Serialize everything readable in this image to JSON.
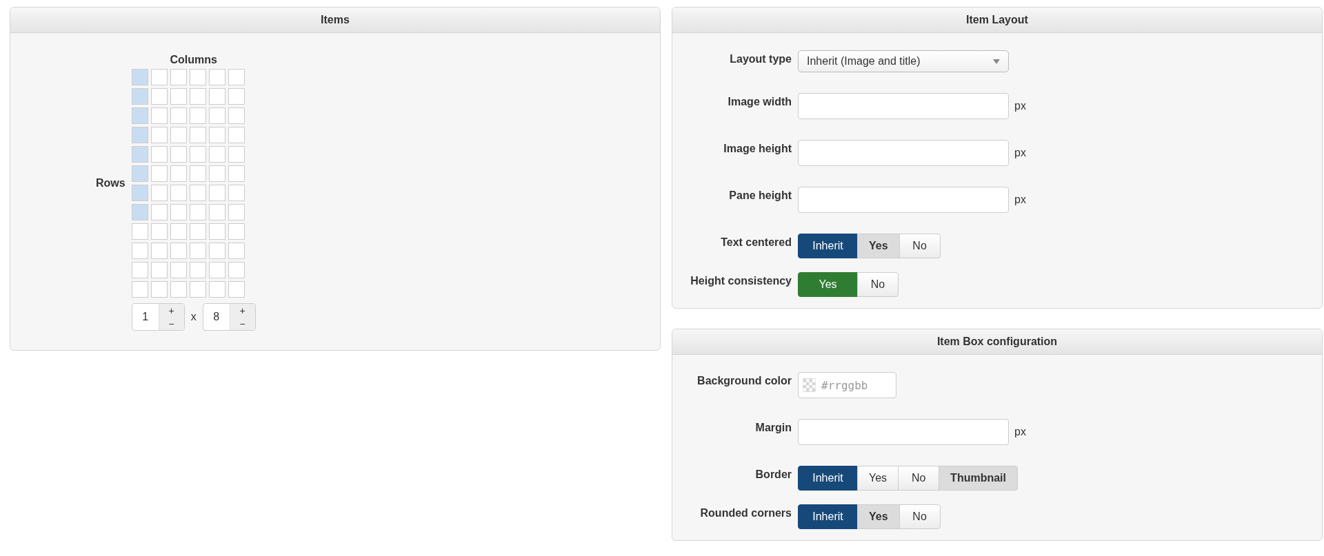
{
  "items_panel": {
    "title": "Items",
    "columns_label": "Columns",
    "rows_label": "Rows",
    "grid": [
      [
        {
          "selected": true
        },
        {
          "selected": false
        },
        {
          "selected": false
        },
        {
          "selected": false
        },
        {
          "selected": false
        },
        {
          "selected": false
        }
      ],
      [
        {
          "selected": true
        },
        {
          "selected": false
        },
        {
          "selected": false
        },
        {
          "selected": false
        },
        {
          "selected": false
        },
        {
          "selected": false
        }
      ],
      [
        {
          "selected": true
        },
        {
          "selected": false
        },
        {
          "selected": false
        },
        {
          "selected": false
        },
        {
          "selected": false
        },
        {
          "selected": false
        }
      ],
      [
        {
          "selected": true
        },
        {
          "selected": false
        },
        {
          "selected": false
        },
        {
          "selected": false
        },
        {
          "selected": false
        },
        {
          "selected": false
        }
      ],
      [
        {
          "selected": true
        },
        {
          "selected": false
        },
        {
          "selected": false
        },
        {
          "selected": false
        },
        {
          "selected": false
        },
        {
          "selected": false
        }
      ],
      [
        {
          "selected": true
        },
        {
          "selected": false
        },
        {
          "selected": false
        },
        {
          "selected": false
        },
        {
          "selected": false
        },
        {
          "selected": false
        }
      ],
      [
        {
          "selected": true
        },
        {
          "selected": false
        },
        {
          "selected": false
        },
        {
          "selected": false
        },
        {
          "selected": false
        },
        {
          "selected": false
        }
      ],
      [
        {
          "selected": true
        },
        {
          "selected": false
        },
        {
          "selected": false
        },
        {
          "selected": false
        },
        {
          "selected": false
        },
        {
          "selected": false
        }
      ],
      [
        {
          "selected": false
        },
        {
          "selected": false
        },
        {
          "selected": false
        },
        {
          "selected": false
        },
        {
          "selected": false
        },
        {
          "selected": false
        }
      ],
      [
        {
          "selected": false
        },
        {
          "selected": false
        },
        {
          "selected": false
        },
        {
          "selected": false
        },
        {
          "selected": false
        },
        {
          "selected": false
        }
      ],
      [
        {
          "selected": false
        },
        {
          "selected": false
        },
        {
          "selected": false
        },
        {
          "selected": false
        },
        {
          "selected": false
        },
        {
          "selected": false
        }
      ],
      [
        {
          "selected": false
        },
        {
          "selected": false
        },
        {
          "selected": false
        },
        {
          "selected": false
        },
        {
          "selected": false
        },
        {
          "selected": false
        }
      ]
    ],
    "steppers": [
      {
        "value": "1",
        "plus": "+",
        "minus": "−"
      },
      {
        "value": "8",
        "plus": "+",
        "minus": "−"
      }
    ],
    "separator": "x"
  },
  "panels": [
    {
      "title": "Item Layout",
      "fields": [
        {
          "kind": "select",
          "label": "Layout type",
          "value": "Inherit (Image and title)"
        },
        {
          "kind": "text",
          "label": "Image width",
          "unit": "px"
        },
        {
          "kind": "text",
          "label": "Image height",
          "unit": "px"
        },
        {
          "kind": "text",
          "label": "Pane height",
          "unit": "px"
        },
        {
          "kind": "toggle",
          "label": "Text centered",
          "color": "#164979",
          "options": [
            {
              "label": "Inherit",
              "selected": true,
              "inherited": false
            },
            {
              "label": "Yes",
              "selected": false,
              "inherited": true
            },
            {
              "label": "No",
              "selected": false,
              "inherited": false
            }
          ]
        },
        {
          "kind": "toggle",
          "label": "Height consistency",
          "color": "#2f7d32",
          "options": [
            {
              "label": "Yes",
              "selected": true,
              "inherited": false
            },
            {
              "label": "No",
              "selected": false,
              "inherited": false
            }
          ]
        }
      ]
    },
    {
      "title": "Item Box configuration",
      "fields": [
        {
          "kind": "color",
          "label": "Background color",
          "placeholder": "#rrggbb"
        },
        {
          "kind": "text",
          "label": "Margin",
          "unit": "px"
        },
        {
          "kind": "toggle",
          "label": "Border",
          "color": "#164979",
          "options": [
            {
              "label": "Inherit",
              "selected": true,
              "inherited": false
            },
            {
              "label": "Yes",
              "selected": false,
              "inherited": false
            },
            {
              "label": "No",
              "selected": false,
              "inherited": false
            },
            {
              "label": "Thumbnail",
              "selected": false,
              "inherited": true
            }
          ]
        },
        {
          "kind": "toggle",
          "label": "Rounded corners",
          "color": "#164979",
          "options": [
            {
              "label": "Inherit",
              "selected": true,
              "inherited": false
            },
            {
              "label": "Yes",
              "selected": false,
              "inherited": true
            },
            {
              "label": "No",
              "selected": false,
              "inherited": false
            }
          ]
        }
      ]
    }
  ]
}
